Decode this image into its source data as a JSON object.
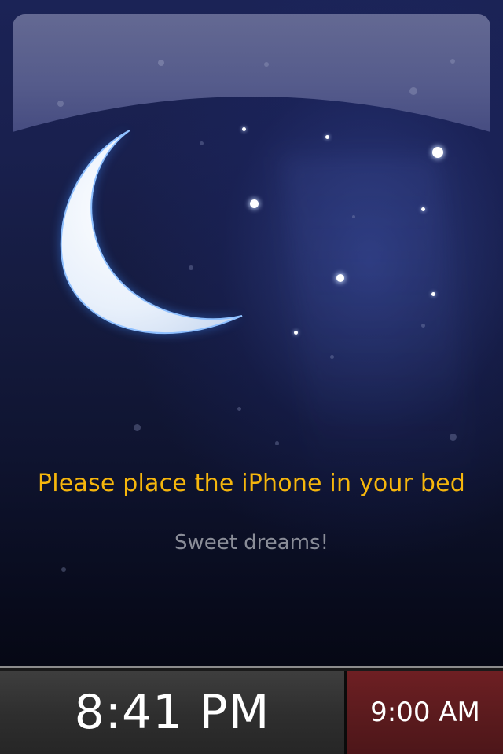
{
  "screen": {
    "message": "Please place the iPhone in your bed",
    "sub_message": "Sweet dreams!"
  },
  "bottom_bar": {
    "current_time": "8:41 PM",
    "alarm_time": "9:00 AM"
  },
  "colors": {
    "message": "#f6b60c",
    "sub_message": "#8a8d98",
    "alarm_panel": "#5c1b1e",
    "clock_panel": "#2f2f2f"
  },
  "icons": [
    "moon-icon",
    "star-icon"
  ]
}
